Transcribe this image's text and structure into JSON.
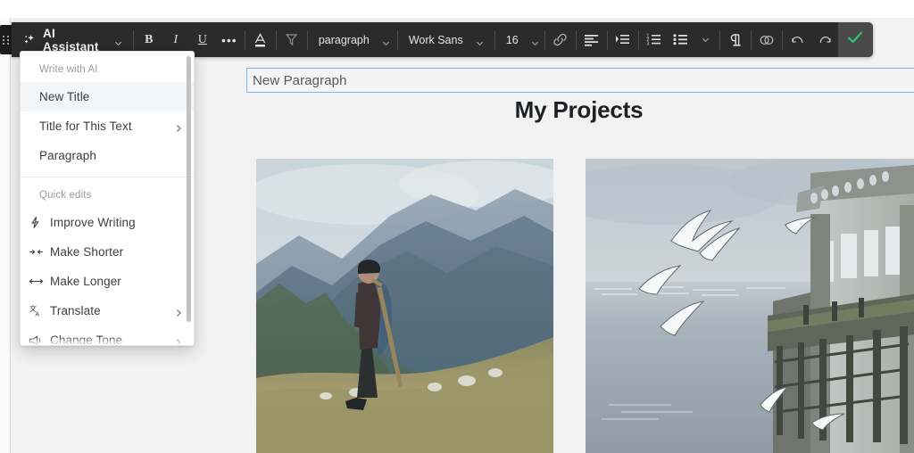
{
  "document": {
    "title_field_value": "New Paragraph",
    "heading": "My Projects",
    "images": [
      {
        "alt": "shepherd-standing-in-mountain-meadow"
      },
      {
        "alt": "seagulls-flying-over-water-near-pier"
      }
    ]
  },
  "toolbar": {
    "grip_icon": "drag-handle-icon",
    "ai_button": {
      "icon": "sparkles-icon",
      "label": "AI Assistant",
      "caret": "chevron-down-icon"
    },
    "buttons": [
      {
        "name": "bold",
        "glyph": "B"
      },
      {
        "name": "italic",
        "glyph": "I"
      },
      {
        "name": "underline",
        "glyph": "U"
      },
      {
        "name": "more-formatting",
        "glyph": "•••"
      }
    ],
    "text_color_icon": "text-color-icon",
    "clear_formatting_icon": "clear-formatting-icon",
    "paragraph_select": {
      "value": "paragraph",
      "caret": "chevron-down-icon"
    },
    "font_select": {
      "value": "Work Sans",
      "caret": "chevron-down-icon"
    },
    "size_select": {
      "value": "16",
      "caret": "chevron-down-icon"
    },
    "link_icon": "link-icon",
    "align_icon": "align-left-icon",
    "indent_icon": "indent-icon",
    "ordered_list_icon": "ordered-list-icon",
    "bulleted_list_icon": "bulleted-list-icon",
    "list_caret": "chevron-down-icon",
    "pilcrow_icon": "pilcrow-icon",
    "anchor_icon": "anchor-link-icon",
    "undo_icon": "undo-icon",
    "redo_icon": "redo-icon",
    "confirm": {
      "icon": "check-icon",
      "color": "#28c46a"
    }
  },
  "ai_menu": {
    "sections": [
      {
        "label": "Write with AI",
        "items": [
          {
            "label": "New Title",
            "active": true,
            "submenu": false,
            "icon": null
          },
          {
            "label": "Title for This Text",
            "active": false,
            "submenu": true,
            "icon": null
          },
          {
            "label": "Paragraph",
            "active": false,
            "submenu": false,
            "icon": null
          }
        ]
      },
      {
        "label": "Quick edits",
        "items": [
          {
            "label": "Improve Writing",
            "active": false,
            "submenu": false,
            "icon": "lightning-bolt-icon"
          },
          {
            "label": "Make Shorter",
            "active": false,
            "submenu": false,
            "icon": "arrows-inward-icon"
          },
          {
            "label": "Make Longer",
            "active": false,
            "submenu": false,
            "icon": "arrows-outward-icon"
          },
          {
            "label": "Translate",
            "active": false,
            "submenu": true,
            "icon": "translate-icon"
          },
          {
            "label": "Change Tone",
            "active": false,
            "submenu": true,
            "icon": "megaphone-icon"
          }
        ]
      }
    ],
    "scrollbar": "vertical-scrollbar"
  },
  "colors": {
    "toolbar_bg": "#2b2b2b",
    "toolbar_accent": "#4a4a4a",
    "confirm_green": "#28c46a",
    "page_bg": "#f2f2f2",
    "menu_active": "#f3f5f7",
    "field_border": "#7eb2e8"
  }
}
